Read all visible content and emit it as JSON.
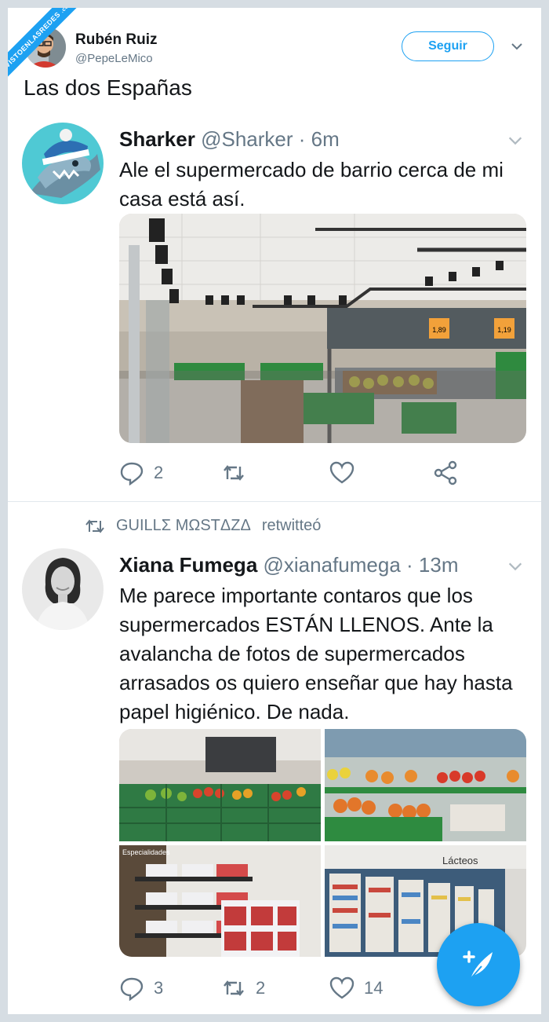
{
  "watermark": "VISTOENLASREDES",
  "watermark_sub": ".com",
  "outer": {
    "name": "Rubén Ruiz",
    "handle": "@PepeLeMico",
    "follow_label": "Seguir",
    "text": "Las dos Españas"
  },
  "tweet1": {
    "name": "Sharker",
    "handle": "@Sharker",
    "time": "· 6m",
    "text": "Ale el supermercado de barrio cerca de mi casa está así.",
    "price_a": "1,89",
    "price_b": "1,19",
    "replies": "2",
    "retweets": "",
    "likes": ""
  },
  "retweeted_by": {
    "name": "GUILLΣ MΩSTΔZΔ",
    "label": "retwitteó"
  },
  "tweet2": {
    "name": "Xiana Fumega",
    "handle": "@xianafumega",
    "time": "· 13m",
    "text": "Me parece importante contaros que los supermercados ESTÁN LLENOS. Ante la avalancha de fotos de supermercados arrasados os quiero enseñar que hay hasta papel higiénico. De nada.",
    "photo4_sign": "Lácteos",
    "photo3_sign": "Especialidades",
    "replies": "3",
    "retweets": "2",
    "likes": "14"
  },
  "colors": {
    "accent": "#1da1f2",
    "muted": "#657786",
    "divider": "#e1e8ed"
  },
  "icons": [
    "chevron-down-icon",
    "reply-icon",
    "retweet-icon",
    "like-icon",
    "share-icon",
    "compose-tweet-icon"
  ]
}
